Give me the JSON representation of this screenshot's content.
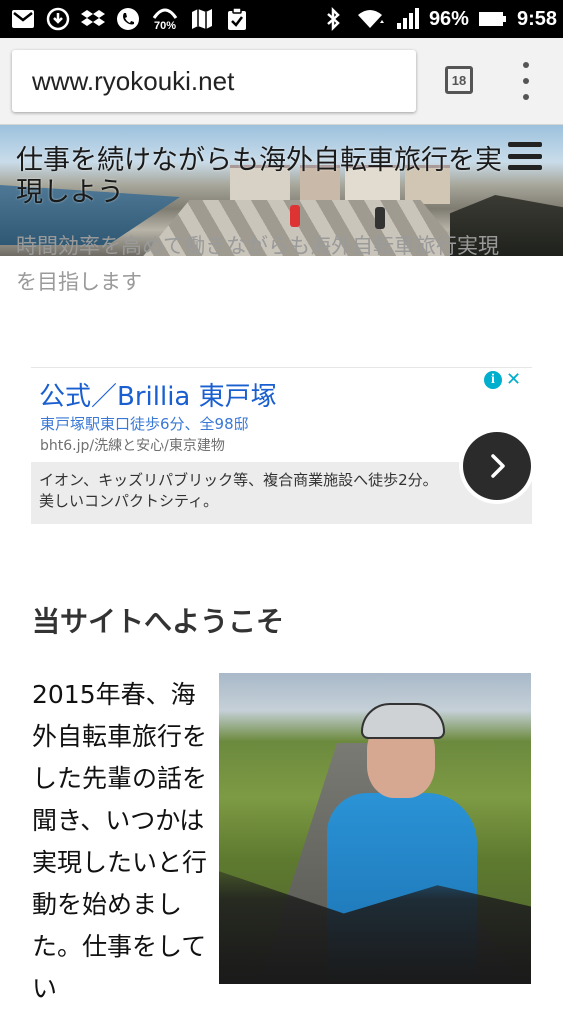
{
  "status_bar": {
    "battery_percent": "96%",
    "time": "9:58",
    "data_saver_percent": "70%",
    "icons": [
      "mail-icon",
      "download-icon",
      "dropbox-icon",
      "phone-icon",
      "data-saver-icon",
      "map-icon",
      "clipboard-check-icon",
      "bluetooth-icon",
      "wifi-icon",
      "signal-icon",
      "battery-icon"
    ]
  },
  "browser": {
    "url": "www.ryokouki.net",
    "tab_count": "18"
  },
  "site": {
    "title": "仕事を続けながらも海外自転車旅行を実現しよう",
    "description": "時間効率を高めて働きながらも海外自転車旅行実現を目指します"
  },
  "ad": {
    "title": "公式／Brillia 東戸塚",
    "subline": "東戸塚駅東口徒歩6分、全98邸",
    "url": "bht6.jp/洗練と安心/東京建物",
    "description": "イオン、キッズリパブリック等、複合商業施設へ徒歩2分。美しいコンパクトシティ。"
  },
  "content": {
    "section_title": "当サイトへようこそ",
    "body": "2015年春、海外自転車旅行をした先輩の話を聞き、いつかは実現したいと行動を始めました。仕事をしてい"
  },
  "colors": {
    "ad_title": "#1a5fd0",
    "ad_accent": "#00aecd",
    "site_desc": "#9a9a9a"
  }
}
